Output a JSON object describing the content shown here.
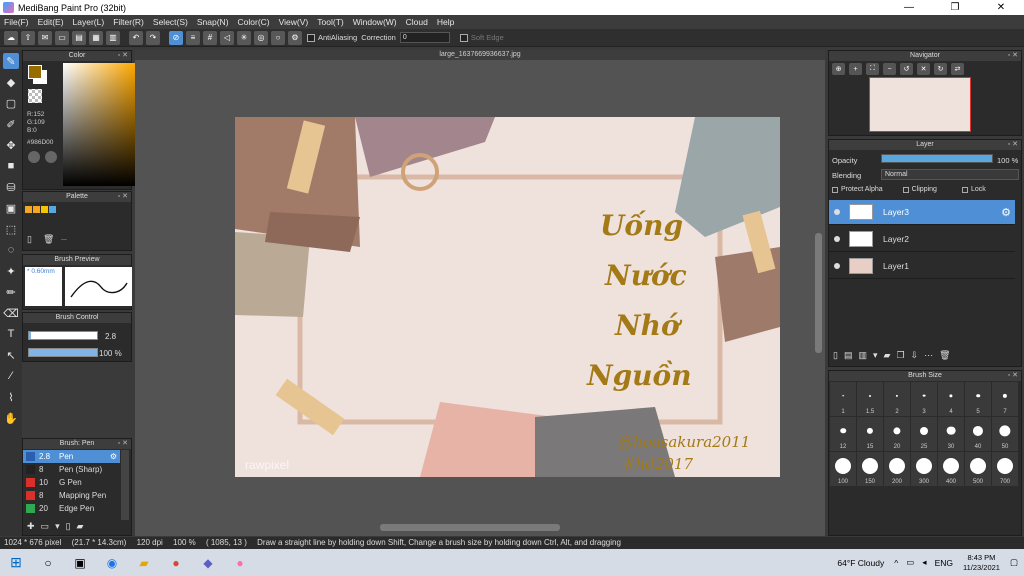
{
  "window": {
    "title": "MediBang Paint Pro (32bit)",
    "minimize": "—",
    "maximize": "❐",
    "close": "✕"
  },
  "menu": [
    "File(F)",
    "Edit(E)",
    "Layer(L)",
    "Filter(R)",
    "Select(S)",
    "Snap(N)",
    "Color(C)",
    "View(V)",
    "Tool(T)",
    "Window(W)",
    "Cloud",
    "Help"
  ],
  "toolbar": {
    "antialiasing_label": "AntiAliasing",
    "correction_label": "Correction",
    "correction_value": "0",
    "soft_edge_label": "Soft Edge"
  },
  "color_panel": {
    "title": "Color",
    "r": "R:152",
    "g": "G:109",
    "b": "B:0",
    "hex": "#986D00",
    "fg_color": "#986D00"
  },
  "palette_panel": {
    "title": "Palette",
    "swatches": [
      "#f5a623",
      "#f5a623",
      "#f5c400",
      "#5aa7e0"
    ],
    "more": "..."
  },
  "brush_preview": {
    "title": "Brush Preview",
    "size": "* 0.60mm"
  },
  "brush_control": {
    "title": "Brush Control",
    "size_value": "2.8",
    "opacity_value": "100 %"
  },
  "brush_panel": {
    "title": "Brush: Pen",
    "items": [
      {
        "num": "2.8",
        "name": "Pen",
        "color": "#2a5fb0",
        "selected": true
      },
      {
        "num": "8",
        "name": "Pen (Sharp)",
        "color": "#222222",
        "selected": false
      },
      {
        "num": "10",
        "name": "G Pen",
        "color": "#d9302c",
        "selected": false
      },
      {
        "num": "8",
        "name": "Mapping Pen",
        "color": "#d9302c",
        "selected": false
      },
      {
        "num": "20",
        "name": "Edge Pen",
        "color": "#2fa84f",
        "selected": false
      }
    ]
  },
  "document": {
    "tab_title": "large_1637669936637.jpg",
    "art_title_lines": [
      "Uống",
      "Nước",
      "Nhớ",
      "Nguồn"
    ],
    "signature_1": "@hoasakura2011",
    "signature_2": "#hd2017",
    "watermark": "rawpixel"
  },
  "navigator": {
    "title": "Navigator"
  },
  "layer_panel": {
    "title": "Layer",
    "opacity_label": "Opacity",
    "opacity_value": "100 %",
    "blending_label": "Blending",
    "blending_value": "Normal",
    "protect_alpha": "Protect Alpha",
    "clipping": "Clipping",
    "lock": "Lock",
    "layers": [
      {
        "name": "Layer3",
        "selected": true
      },
      {
        "name": "Layer2",
        "selected": false
      },
      {
        "name": "Layer1",
        "selected": false
      }
    ]
  },
  "brush_size_panel": {
    "title": "Brush Size",
    "sizes": [
      "1",
      "1.5",
      "2",
      "3",
      "4",
      "5",
      "7",
      "12",
      "15",
      "20",
      "25",
      "30",
      "40",
      "50",
      "100",
      "150",
      "200",
      "300",
      "400",
      "500",
      "700"
    ]
  },
  "status": {
    "dimensions": "1024 * 676 pixel",
    "physical": "(21.7 * 14.3cm)",
    "dpi": "120 dpi",
    "zoom": "100 %",
    "cursor": "( 1085, 13 )",
    "hint": "Draw a straight line by holding down Shift, Change a brush size by holding down Ctrl, Alt, and dragging"
  },
  "taskbar": {
    "weather": "64°F  Cloudy",
    "lang": "ENG",
    "time": "8:43 PM",
    "date": "11/23/2021"
  }
}
